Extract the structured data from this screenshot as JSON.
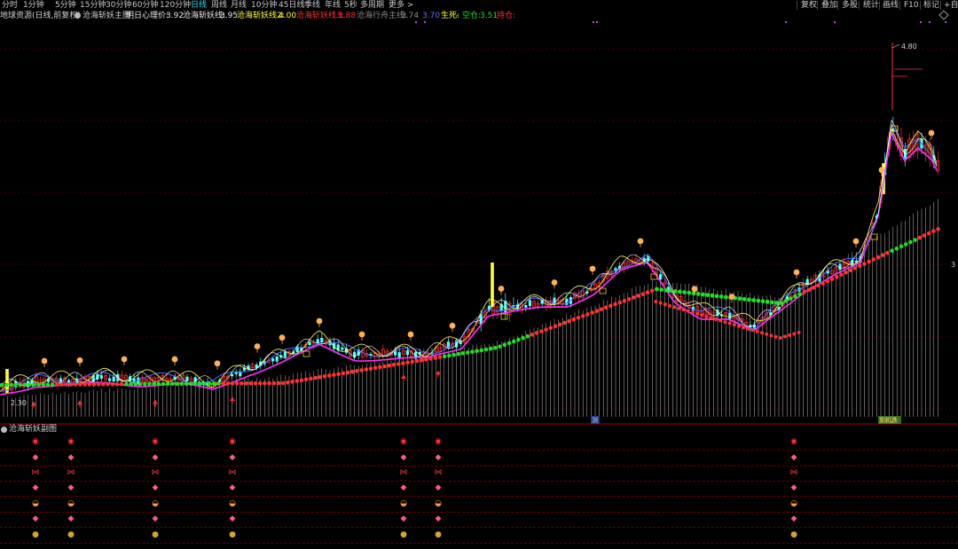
{
  "toolbar": {
    "periods": [
      "分时",
      "1分钟",
      "5分钟",
      "15分钟",
      "30分钟",
      "60分钟",
      "120分钟",
      "日线",
      "周线",
      "月线",
      "10分钟",
      "45日线",
      "季线",
      "年线",
      "5秒",
      "多周期",
      "更多 >"
    ],
    "active_period": "日线",
    "buttons": [
      "复权",
      "叠加",
      "多股",
      "统计",
      "画线",
      "F10",
      "标记",
      "+自选"
    ]
  },
  "info": {
    "stock": "地球资源(日线,前复权)",
    "indicator": "沧海斩妖主图",
    "f1_label": "明日心理价:",
    "f1_value": "3.92",
    "f2_label": "沧海斩妖线:",
    "f2_value": "3.95",
    "f3_label": "沧海斩妖线2:",
    "f3_value": "4.00",
    "f4_label": "沧海斩妖线3:",
    "f4_value": "3.88",
    "f5_label": "沧海行舟主线:",
    "f5_value": "3.74",
    "f6_value": "3.70",
    "f7_label": "生死:",
    "f7_value": "-",
    "f8_label": "空仓:",
    "f8_value": "3.51",
    "f9_label": "持仓:"
  },
  "chart_labels": {
    "high": "4.80",
    "low": "2.30",
    "date_tag": "测",
    "event_tag": "到机跌",
    "right_tick": "3"
  },
  "sub": {
    "title": "沧海斩妖副图"
  },
  "signal_rows": [
    {
      "icon": "signal-ball-icon",
      "glyph": "◉",
      "color": "red",
      "cols": [
        40,
        80,
        175,
        262,
        455,
        494,
        895
      ]
    },
    {
      "icon": "gem-icon",
      "glyph": "◆",
      "color": "pink",
      "cols": [
        40,
        80,
        175,
        262,
        455,
        494,
        895
      ]
    },
    {
      "icon": "butterfly-icon",
      "glyph": "⋈",
      "color": "red",
      "cols": [
        40,
        80,
        175,
        262,
        455,
        494,
        895
      ]
    },
    {
      "icon": "gem-icon",
      "glyph": "◆",
      "color": "pink",
      "cols": [
        40,
        80,
        175,
        262,
        455,
        494,
        895
      ]
    },
    {
      "icon": "ingot-icon",
      "glyph": "◒",
      "color": "orange",
      "cols": [
        40,
        80,
        175,
        262,
        455,
        494,
        895
      ]
    },
    {
      "icon": "gem-icon",
      "glyph": "◆",
      "color": "pink",
      "cols": [
        40,
        80,
        175,
        262,
        455,
        494,
        895
      ]
    },
    {
      "icon": "money-bag-icon",
      "glyph": "●",
      "color": "gold",
      "cols": [
        40,
        80,
        175,
        262,
        455,
        494,
        895
      ]
    }
  ],
  "colors": {
    "bg": "#000000",
    "up": "#ff3232",
    "down": "#54ffff",
    "main": "#e040e0",
    "yellow": "#ffff3a",
    "green": "#22dd22",
    "grid": "#8a0000"
  }
}
